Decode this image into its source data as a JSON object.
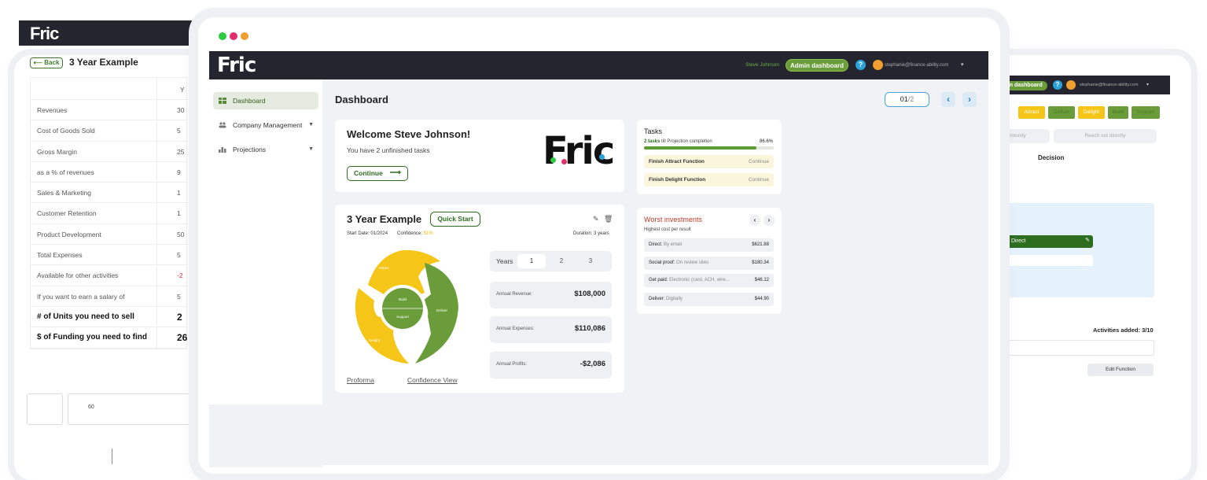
{
  "left_window": {
    "logo": "Fric",
    "back_label": "Back",
    "title": "3 Year Example",
    "rows": [
      {
        "label": "Revenues",
        "value": "30"
      },
      {
        "label": "Cost of Goods Sold",
        "value": "5"
      },
      {
        "label": "Gross Margin",
        "value": "25"
      },
      {
        "label": "as a % of revenues",
        "value": "9"
      },
      {
        "label": "Sales & Marketing",
        "value": "1"
      },
      {
        "label": "Customer Retention",
        "value": "1"
      },
      {
        "label": "Product Development",
        "value": "50"
      },
      {
        "label": "Total Expenses",
        "value": "5"
      },
      {
        "label": "Available for other activities",
        "value": "-2"
      },
      {
        "label": "If you want to earn a salary of",
        "value": "5"
      },
      {
        "label": "# of Units you need to sell",
        "value": "2"
      },
      {
        "label": "$ of Funding you need to find",
        "value": "26"
      }
    ],
    "column_header": "Y",
    "chart_tick": "60"
  },
  "right_window": {
    "admin_label": "Admin dashboard",
    "help": "?",
    "email": "stephanie@finance-ability.com",
    "chips": [
      {
        "label": "Attract",
        "color": "#f5c518"
      },
      {
        "label": "Deliver",
        "color": "#6a9c3a"
      },
      {
        "label": "Delight",
        "color": "#f5c518"
      },
      {
        "label": "Build",
        "color": "#6a9c3a"
      },
      {
        "label": "Support",
        "color": "#6a9c3a"
      }
    ],
    "community": "mmunity",
    "reach_out": "Reach out directly",
    "decision": "Decision",
    "direct": "Direct",
    "activities_added": "Activities added: 3/10",
    "view_link": "e View",
    "edit_function": "Edit Function"
  },
  "header": {
    "logo": "Fric",
    "user_name": "Steve Johnson",
    "admin_label": "Admin dashboard",
    "help": "?",
    "email": "stephanie@finance-ability.com",
    "caret": "▾"
  },
  "sidebar": {
    "items": [
      {
        "label": "Dashboard",
        "active": true
      },
      {
        "label": "Company Management"
      },
      {
        "label": "Projections"
      }
    ]
  },
  "main": {
    "title": "Dashboard",
    "pager_current": "01",
    "pager_total": "/2",
    "welcome": {
      "title": "Welcome Steve Johnson!",
      "subtitle": "You have 2 unfinished tasks",
      "continue_label": "Continue"
    },
    "big_logo": "Fric",
    "tasks": {
      "title": "Tasks",
      "subtitle_bold": "2 tasks",
      "subtitle_rest": " till Projection completion",
      "percent": "86.6%",
      "progress": 0.866,
      "items": [
        {
          "label": "Finish Attract Function",
          "action": "Continue"
        },
        {
          "label": "Finish Delight Function",
          "action": "Continue"
        }
      ]
    },
    "example": {
      "title": "3 Year Example",
      "quick_start": "Quick Start",
      "start_date": "Start Date: 01/2024",
      "confidence_label": "Confidence: ",
      "confidence_value": "51%",
      "duration": "Duration: 3 years",
      "years_label": "Years",
      "years": [
        "1",
        "2",
        "3"
      ],
      "wheel_labels": {
        "attract": "Attract",
        "deliver": "Deliver",
        "delight": "Delight",
        "build": "Build",
        "support": "Support"
      },
      "financials": [
        {
          "label": "Annual Revenue:",
          "value": "$108,000"
        },
        {
          "label": "Annual Expenses:",
          "value": "$110,086"
        },
        {
          "label": "Annual Profits:",
          "value": "-$2,086"
        }
      ],
      "link_proforma": "Proforma",
      "link_confidence": "Confidence View"
    },
    "worst": {
      "title": "Worst investments",
      "subtitle": "Highest cost per result",
      "items": [
        {
          "name": "Direct:",
          "detail": " By email",
          "amount": "$621.88"
        },
        {
          "name": "Social proof:",
          "detail": " On review sites",
          "amount": "$180.34"
        },
        {
          "name": "Get paid:",
          "detail": " Electronic (card, ACH, wire...",
          "amount": "$46.12"
        },
        {
          "name": "Deliver:",
          "detail": " Digitally",
          "amount": "$44.90"
        }
      ]
    }
  },
  "colors": {
    "dark_bar": "#24252f",
    "green": "#2d6d1f",
    "yellow": "#f5c518",
    "accent_blue": "#2aa3d8"
  }
}
